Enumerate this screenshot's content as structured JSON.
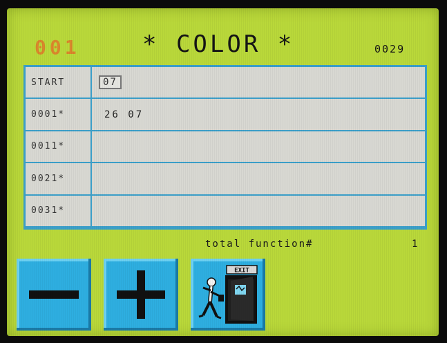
{
  "header": {
    "program_number": "001",
    "title": "* COLOR *",
    "counter": "0029"
  },
  "rows": [
    {
      "label": "START",
      "value": "07",
      "boxed": true
    },
    {
      "label": "0001*",
      "value": "26 07",
      "boxed": false
    },
    {
      "label": "0011*",
      "value": "",
      "boxed": false
    },
    {
      "label": "0021*",
      "value": "",
      "boxed": false
    },
    {
      "label": "0031*",
      "value": "",
      "boxed": false
    }
  ],
  "footer": {
    "total_label": "total function#",
    "total_value": "1"
  },
  "buttons": {
    "minus_icon": "minus-icon",
    "plus_icon": "plus-icon",
    "exit_icon": "exit-door-icon",
    "exit_sign": "EXIT"
  },
  "colors": {
    "screen_background": "#b9d83a",
    "table_border": "#3b9fc9",
    "button": "#2eaee0",
    "program_number": "#e07a2a"
  }
}
